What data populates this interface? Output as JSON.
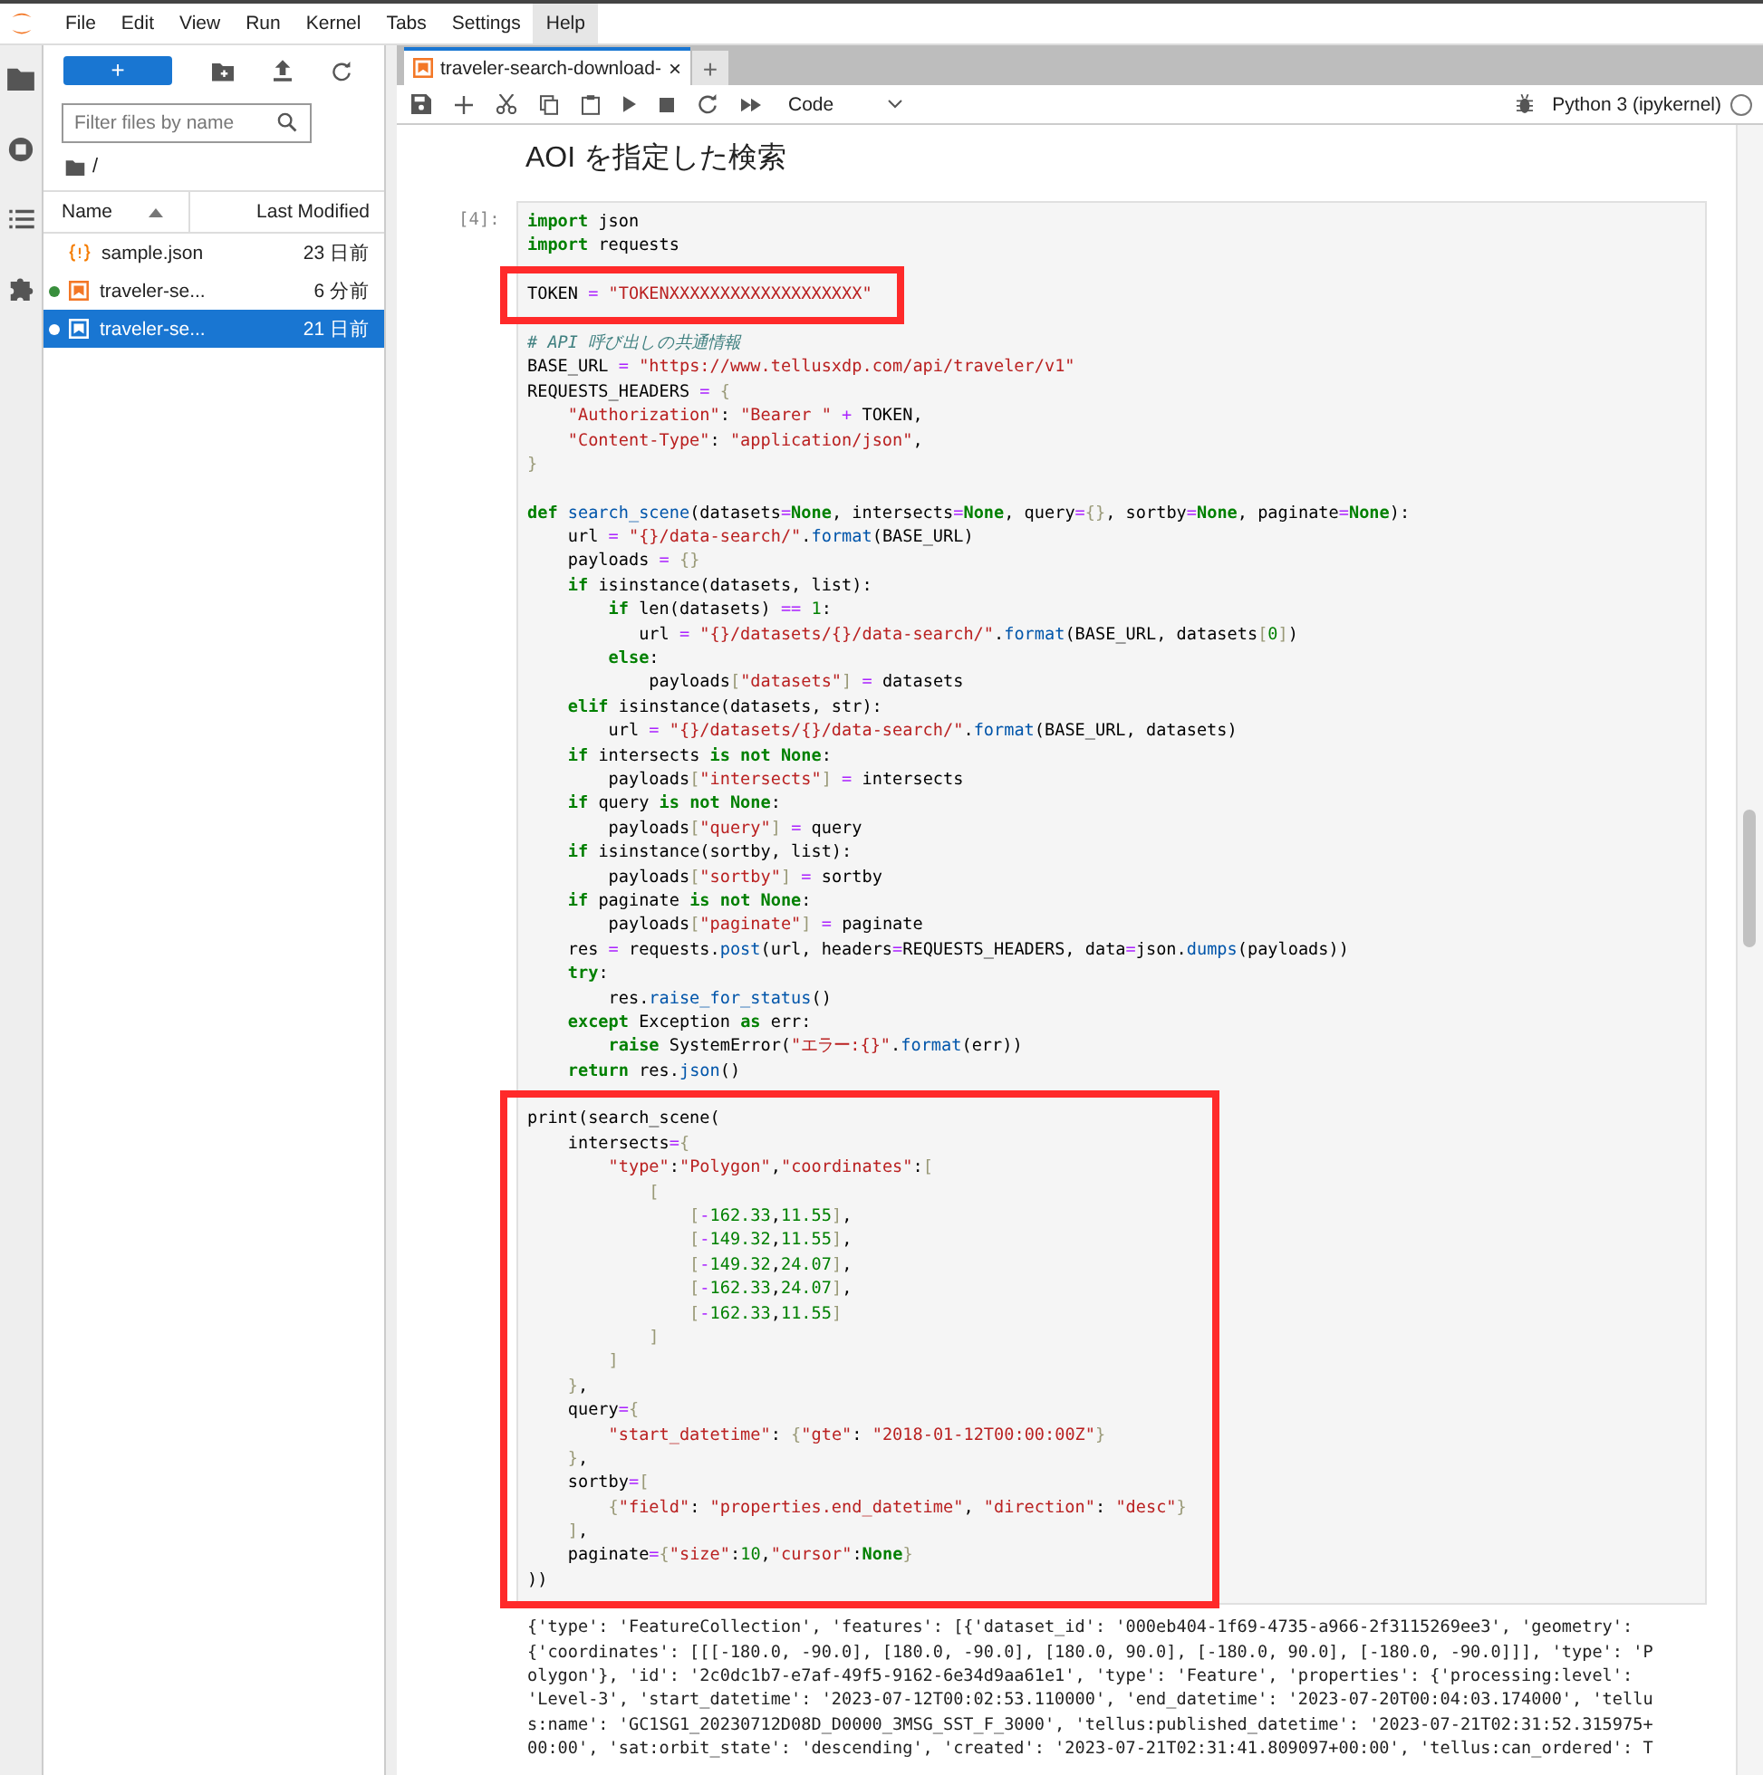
{
  "menu": [
    {
      "label": "File",
      "selected": false
    },
    {
      "label": "Edit",
      "selected": false
    },
    {
      "label": "View",
      "selected": false
    },
    {
      "label": "Run",
      "selected": false
    },
    {
      "label": "Kernel",
      "selected": false
    },
    {
      "label": "Tabs",
      "selected": false
    },
    {
      "label": "Settings",
      "selected": false
    },
    {
      "label": "Help",
      "selected": true
    }
  ],
  "file_browser": {
    "new_button": "+",
    "filter_placeholder": "Filter files by name",
    "path": "/",
    "columns": [
      "Name",
      "Last Modified"
    ],
    "files": [
      {
        "name": "sample.json",
        "modified": "23 日前",
        "kind": "json",
        "running": false,
        "selected": false
      },
      {
        "name": "traveler-se...",
        "modified": "6 分前",
        "kind": "notebook",
        "running": true,
        "selected": false
      },
      {
        "name": "traveler-se...",
        "modified": "21 日前",
        "kind": "notebook",
        "running": true,
        "selected": true
      }
    ]
  },
  "tabs": [
    {
      "label": "traveler-search-download-",
      "close": "×",
      "selected": true
    }
  ],
  "new_tab": "+",
  "toolbar": {
    "cell_type": "Code",
    "kernel": "Python 3 (ipykernel)",
    "kernel_busy": false
  },
  "notebook": {
    "heading": "AOI を指定した検索",
    "cells": [
      {
        "prompt": "[4]:",
        "blocks": [
          {
            "highlighted": false,
            "lines": [
              [
                {
                  "kind": "kw",
                  "text": "import"
                },
                {
                  "kind": "plain",
                  "text": " json"
                }
              ],
              [
                {
                  "kind": "kw",
                  "text": "import"
                },
                {
                  "kind": "plain",
                  "text": " requests"
                }
              ]
            ]
          },
          {
            "highlighted": true,
            "lines": [
              [
                {
                  "kind": "plain",
                  "text": "TOKEN"
                },
                {
                  "kind": "op",
                  "text": " = "
                },
                {
                  "kind": "str",
                  "text": "\"TOKENXXXXXXXXXXXXXXXXXXX\""
                }
              ]
            ]
          },
          {
            "highlighted": false,
            "lines": [
              [
                {
                  "kind": "comment",
                  "text": "# API 呼び出しの共通情報"
                }
              ],
              [
                {
                  "kind": "plain",
                  "text": "BASE_URL"
                },
                {
                  "kind": "op",
                  "text": " = "
                },
                {
                  "kind": "str",
                  "text": "\"https://www.tellusxdp.com/api/traveler/v1\""
                }
              ],
              [
                {
                  "kind": "plain",
                  "text": "REQUESTS_HEADERS"
                },
                {
                  "kind": "op",
                  "text": " = "
                },
                {
                  "kind": "br",
                  "text": "{"
                }
              ],
              [
                {
                  "kind": "str",
                  "text": "    \"Authorization\""
                },
                {
                  "kind": "plain",
                  "text": ": "
                },
                {
                  "kind": "str",
                  "text": "\"Bearer \""
                },
                {
                  "kind": "op",
                  "text": " + "
                },
                {
                  "kind": "plain",
                  "text": "TOKEN,"
                }
              ],
              [
                {
                  "kind": "str",
                  "text": "    \"Content-Type\""
                },
                {
                  "kind": "plain",
                  "text": ": "
                },
                {
                  "kind": "str",
                  "text": "\"application/json\""
                },
                {
                  "kind": "plain",
                  "text": ","
                }
              ],
              [
                {
                  "kind": "br",
                  "text": "}"
                }
              ]
            ]
          },
          {
            "highlighted": false,
            "lines": [
              [
                {
                  "kind": "kw",
                  "text": "def"
                },
                {
                  "kind": "fn",
                  "text": " search_scene"
                },
                {
                  "kind": "plain",
                  "text": "(datasets"
                },
                {
                  "kind": "op",
                  "text": "="
                },
                {
                  "kind": "kw",
                  "text": "None"
                },
                {
                  "kind": "plain",
                  "text": ", intersects"
                },
                {
                  "kind": "op",
                  "text": "="
                },
                {
                  "kind": "kw",
                  "text": "None"
                },
                {
                  "kind": "plain",
                  "text": ", query"
                },
                {
                  "kind": "op",
                  "text": "="
                },
                {
                  "kind": "br",
                  "text": "{}"
                },
                {
                  "kind": "plain",
                  "text": ", sortby"
                },
                {
                  "kind": "op",
                  "text": "="
                },
                {
                  "kind": "kw",
                  "text": "None"
                },
                {
                  "kind": "plain",
                  "text": ", paginate"
                },
                {
                  "kind": "op",
                  "text": "="
                },
                {
                  "kind": "kw",
                  "text": "None"
                },
                {
                  "kind": "plain",
                  "text": "):"
                }
              ],
              [
                {
                  "kind": "plain",
                  "text": "    url"
                },
                {
                  "kind": "op",
                  "text": " = "
                },
                {
                  "kind": "str",
                  "text": "\"{}/data-search/\""
                },
                {
                  "kind": "plain",
                  "text": "."
                },
                {
                  "kind": "fn",
                  "text": "format"
                },
                {
                  "kind": "plain",
                  "text": "(BASE_URL)"
                }
              ],
              [
                {
                  "kind": "plain",
                  "text": "    payloads"
                },
                {
                  "kind": "op",
                  "text": " = "
                },
                {
                  "kind": "br",
                  "text": "{}"
                }
              ],
              [
                {
                  "kind": "kw",
                  "text": "    if"
                },
                {
                  "kind": "plain",
                  "text": " isinstance(datasets, list):"
                }
              ],
              [
                {
                  "kind": "kw",
                  "text": "        if"
                },
                {
                  "kind": "plain",
                  "text": " len(datasets)"
                },
                {
                  "kind": "op",
                  "text": " == "
                },
                {
                  "kind": "num",
                  "text": "1"
                },
                {
                  "kind": "plain",
                  "text": ":"
                }
              ],
              [
                {
                  "kind": "plain",
                  "text": "           url"
                },
                {
                  "kind": "op",
                  "text": " = "
                },
                {
                  "kind": "str",
                  "text": "\"{}/datasets/{}/data-search/\""
                },
                {
                  "kind": "plain",
                  "text": "."
                },
                {
                  "kind": "fn",
                  "text": "format"
                },
                {
                  "kind": "plain",
                  "text": "(BASE_URL, datasets"
                },
                {
                  "kind": "br",
                  "text": "["
                },
                {
                  "kind": "num",
                  "text": "0"
                },
                {
                  "kind": "br",
                  "text": "]"
                },
                {
                  "kind": "plain",
                  "text": ")"
                }
              ],
              [
                {
                  "kind": "kw",
                  "text": "        else"
                },
                {
                  "kind": "plain",
                  "text": ":"
                }
              ],
              [
                {
                  "kind": "plain",
                  "text": "            payloads"
                },
                {
                  "kind": "br",
                  "text": "["
                },
                {
                  "kind": "str",
                  "text": "\"datasets\""
                },
                {
                  "kind": "br",
                  "text": "]"
                },
                {
                  "kind": "op",
                  "text": " = "
                },
                {
                  "kind": "plain",
                  "text": "datasets"
                }
              ],
              [
                {
                  "kind": "kw",
                  "text": "    elif"
                },
                {
                  "kind": "plain",
                  "text": " isinstance(datasets, str):"
                }
              ],
              [
                {
                  "kind": "plain",
                  "text": "        url"
                },
                {
                  "kind": "op",
                  "text": " = "
                },
                {
                  "kind": "str",
                  "text": "\"{}/datasets/{}/data-search/\""
                },
                {
                  "kind": "plain",
                  "text": "."
                },
                {
                  "kind": "fn",
                  "text": "format"
                },
                {
                  "kind": "plain",
                  "text": "(BASE_URL, datasets)"
                }
              ],
              [
                {
                  "kind": "kw",
                  "text": "    if"
                },
                {
                  "kind": "plain",
                  "text": " intersects "
                },
                {
                  "kind": "kw",
                  "text": "is not None"
                },
                {
                  "kind": "plain",
                  "text": ":"
                }
              ],
              [
                {
                  "kind": "plain",
                  "text": "        payloads"
                },
                {
                  "kind": "br",
                  "text": "["
                },
                {
                  "kind": "str",
                  "text": "\"intersects\""
                },
                {
                  "kind": "br",
                  "text": "]"
                },
                {
                  "kind": "op",
                  "text": " = "
                },
                {
                  "kind": "plain",
                  "text": "intersects"
                }
              ],
              [
                {
                  "kind": "kw",
                  "text": "    if"
                },
                {
                  "kind": "plain",
                  "text": " query "
                },
                {
                  "kind": "kw",
                  "text": "is not None"
                },
                {
                  "kind": "plain",
                  "text": ":"
                }
              ],
              [
                {
                  "kind": "plain",
                  "text": "        payloads"
                },
                {
                  "kind": "br",
                  "text": "["
                },
                {
                  "kind": "str",
                  "text": "\"query\""
                },
                {
                  "kind": "br",
                  "text": "]"
                },
                {
                  "kind": "op",
                  "text": " = "
                },
                {
                  "kind": "plain",
                  "text": "query"
                }
              ],
              [
                {
                  "kind": "kw",
                  "text": "    if"
                },
                {
                  "kind": "plain",
                  "text": " isinstance(sortby, list):"
                }
              ],
              [
                {
                  "kind": "plain",
                  "text": "        payloads"
                },
                {
                  "kind": "br",
                  "text": "["
                },
                {
                  "kind": "str",
                  "text": "\"sortby\""
                },
                {
                  "kind": "br",
                  "text": "]"
                },
                {
                  "kind": "op",
                  "text": " = "
                },
                {
                  "kind": "plain",
                  "text": "sortby"
                }
              ],
              [
                {
                  "kind": "kw",
                  "text": "    if"
                },
                {
                  "kind": "plain",
                  "text": " paginate "
                },
                {
                  "kind": "kw",
                  "text": "is not None"
                },
                {
                  "kind": "plain",
                  "text": ":"
                }
              ],
              [
                {
                  "kind": "plain",
                  "text": "        payloads"
                },
                {
                  "kind": "br",
                  "text": "["
                },
                {
                  "kind": "str",
                  "text": "\"paginate\""
                },
                {
                  "kind": "br",
                  "text": "]"
                },
                {
                  "kind": "op",
                  "text": " = "
                },
                {
                  "kind": "plain",
                  "text": "paginate"
                }
              ],
              [
                {
                  "kind": "plain",
                  "text": "    res"
                },
                {
                  "kind": "op",
                  "text": " = "
                },
                {
                  "kind": "plain",
                  "text": "requests."
                },
                {
                  "kind": "fn",
                  "text": "post"
                },
                {
                  "kind": "plain",
                  "text": "(url, headers"
                },
                {
                  "kind": "op",
                  "text": "="
                },
                {
                  "kind": "plain",
                  "text": "REQUESTS_HEADERS, data"
                },
                {
                  "kind": "op",
                  "text": "="
                },
                {
                  "kind": "plain",
                  "text": "json."
                },
                {
                  "kind": "fn",
                  "text": "dumps"
                },
                {
                  "kind": "plain",
                  "text": "(payloads))"
                }
              ],
              [
                {
                  "kind": "kw",
                  "text": "    try"
                },
                {
                  "kind": "plain",
                  "text": ":"
                }
              ],
              [
                {
                  "kind": "plain",
                  "text": "        res."
                },
                {
                  "kind": "fn",
                  "text": "raise_for_status"
                },
                {
                  "kind": "plain",
                  "text": "()"
                }
              ],
              [
                {
                  "kind": "kw",
                  "text": "    except"
                },
                {
                  "kind": "plain",
                  "text": " Exception "
                },
                {
                  "kind": "kw",
                  "text": "as"
                },
                {
                  "kind": "plain",
                  "text": " err:"
                }
              ],
              [
                {
                  "kind": "kw",
                  "text": "        raise"
                },
                {
                  "kind": "plain",
                  "text": " SystemError("
                },
                {
                  "kind": "str",
                  "text": "\"エラー:{}\""
                },
                {
                  "kind": "plain",
                  "text": "."
                },
                {
                  "kind": "fn",
                  "text": "format"
                },
                {
                  "kind": "plain",
                  "text": "(err))"
                }
              ],
              [
                {
                  "kind": "kw",
                  "text": "    return"
                },
                {
                  "kind": "plain",
                  "text": " res."
                },
                {
                  "kind": "fn",
                  "text": "json"
                },
                {
                  "kind": "plain",
                  "text": "()"
                }
              ]
            ]
          },
          {
            "highlighted": true,
            "lines": [
              [
                {
                  "kind": "plain",
                  "text": "print(search_scene("
                }
              ],
              [
                {
                  "kind": "plain",
                  "text": "    intersects"
                },
                {
                  "kind": "op",
                  "text": "="
                },
                {
                  "kind": "br",
                  "text": "{"
                }
              ],
              [
                {
                  "kind": "str",
                  "text": "        \"type\""
                },
                {
                  "kind": "plain",
                  "text": ":"
                },
                {
                  "kind": "str",
                  "text": "\"Polygon\""
                },
                {
                  "kind": "plain",
                  "text": ","
                },
                {
                  "kind": "str",
                  "text": "\"coordinates\""
                },
                {
                  "kind": "plain",
                  "text": ":"
                },
                {
                  "kind": "br",
                  "text": "["
                }
              ],
              [
                {
                  "kind": "br",
                  "text": "            ["
                }
              ],
              [
                {
                  "kind": "br",
                  "text": "                ["
                },
                {
                  "kind": "op",
                  "text": "-"
                },
                {
                  "kind": "num",
                  "text": "162.33"
                },
                {
                  "kind": "plain",
                  "text": ","
                },
                {
                  "kind": "num",
                  "text": "11.55"
                },
                {
                  "kind": "br",
                  "text": "]"
                },
                {
                  "kind": "plain",
                  "text": ","
                }
              ],
              [
                {
                  "kind": "br",
                  "text": "                ["
                },
                {
                  "kind": "op",
                  "text": "-"
                },
                {
                  "kind": "num",
                  "text": "149.32"
                },
                {
                  "kind": "plain",
                  "text": ","
                },
                {
                  "kind": "num",
                  "text": "11.55"
                },
                {
                  "kind": "br",
                  "text": "]"
                },
                {
                  "kind": "plain",
                  "text": ","
                }
              ],
              [
                {
                  "kind": "br",
                  "text": "                ["
                },
                {
                  "kind": "op",
                  "text": "-"
                },
                {
                  "kind": "num",
                  "text": "149.32"
                },
                {
                  "kind": "plain",
                  "text": ","
                },
                {
                  "kind": "num",
                  "text": "24.07"
                },
                {
                  "kind": "br",
                  "text": "]"
                },
                {
                  "kind": "plain",
                  "text": ","
                }
              ],
              [
                {
                  "kind": "br",
                  "text": "                ["
                },
                {
                  "kind": "op",
                  "text": "-"
                },
                {
                  "kind": "num",
                  "text": "162.33"
                },
                {
                  "kind": "plain",
                  "text": ","
                },
                {
                  "kind": "num",
                  "text": "24.07"
                },
                {
                  "kind": "br",
                  "text": "]"
                },
                {
                  "kind": "plain",
                  "text": ","
                }
              ],
              [
                {
                  "kind": "br",
                  "text": "                ["
                },
                {
                  "kind": "op",
                  "text": "-"
                },
                {
                  "kind": "num",
                  "text": "162.33"
                },
                {
                  "kind": "plain",
                  "text": ","
                },
                {
                  "kind": "num",
                  "text": "11.55"
                },
                {
                  "kind": "br",
                  "text": "]"
                }
              ],
              [
                {
                  "kind": "br",
                  "text": "            ]"
                }
              ],
              [
                {
                  "kind": "br",
                  "text": "        ]"
                }
              ],
              [
                {
                  "kind": "br",
                  "text": "    }"
                },
                {
                  "kind": "plain",
                  "text": ","
                }
              ],
              [
                {
                  "kind": "plain",
                  "text": "    query"
                },
                {
                  "kind": "op",
                  "text": "="
                },
                {
                  "kind": "br",
                  "text": "{"
                }
              ],
              [
                {
                  "kind": "str",
                  "text": "        \"start_datetime\""
                },
                {
                  "kind": "plain",
                  "text": ": "
                },
                {
                  "kind": "br",
                  "text": "{"
                },
                {
                  "kind": "str",
                  "text": "\"gte\""
                },
                {
                  "kind": "plain",
                  "text": ": "
                },
                {
                  "kind": "str",
                  "text": "\"2018-01-12T00:00:00Z\""
                },
                {
                  "kind": "br",
                  "text": "}"
                }
              ],
              [
                {
                  "kind": "br",
                  "text": "    }"
                },
                {
                  "kind": "plain",
                  "text": ","
                }
              ],
              [
                {
                  "kind": "plain",
                  "text": "    sortby"
                },
                {
                  "kind": "op",
                  "text": "="
                },
                {
                  "kind": "br",
                  "text": "["
                }
              ],
              [
                {
                  "kind": "br",
                  "text": "        {"
                },
                {
                  "kind": "str",
                  "text": "\"field\""
                },
                {
                  "kind": "plain",
                  "text": ": "
                },
                {
                  "kind": "str",
                  "text": "\"properties.end_datetime\""
                },
                {
                  "kind": "plain",
                  "text": ", "
                },
                {
                  "kind": "str",
                  "text": "\"direction\""
                },
                {
                  "kind": "plain",
                  "text": ": "
                },
                {
                  "kind": "str",
                  "text": "\"desc\""
                },
                {
                  "kind": "br",
                  "text": "}"
                }
              ],
              [
                {
                  "kind": "br",
                  "text": "    ]"
                },
                {
                  "kind": "plain",
                  "text": ","
                }
              ],
              [
                {
                  "kind": "plain",
                  "text": "    paginate"
                },
                {
                  "kind": "op",
                  "text": "="
                },
                {
                  "kind": "br",
                  "text": "{"
                },
                {
                  "kind": "str",
                  "text": "\"size\""
                },
                {
                  "kind": "plain",
                  "text": ":"
                },
                {
                  "kind": "num",
                  "text": "10"
                },
                {
                  "kind": "plain",
                  "text": ","
                },
                {
                  "kind": "str",
                  "text": "\"cursor\""
                },
                {
                  "kind": "plain",
                  "text": ":"
                },
                {
                  "kind": "kw",
                  "text": "None"
                },
                {
                  "kind": "br",
                  "text": "}"
                }
              ],
              [
                {
                  "kind": "plain",
                  "text": "))"
                }
              ]
            ]
          }
        ],
        "output": [
          "{'type': 'FeatureCollection', 'features': [{'dataset_id': '000eb404-1f69-4735-a966-2f3115269ee3', 'geometry':",
          "{'coordinates': [[[-180.0, -90.0], [180.0, -90.0], [180.0, 90.0], [-180.0, 90.0], [-180.0, -90.0]]], 'type': 'P",
          "olygon'}, 'id': '2c0dc1b7-e7af-49f5-9162-6e34d9aa61e1', 'type': 'Feature', 'properties': {'processing:level':",
          "'Level-3', 'start_datetime': '2023-07-12T00:02:53.110000', 'end_datetime': '2023-07-20T00:04:03.174000', 'tellu",
          "s:name': 'GC1SG1_20230712D08D_D0000_3MSG_SST_F_3000', 'tellus:published_datetime': '2023-07-21T02:31:52.315975+",
          "00:00', 'sat:orbit_state': 'descending', 'created': '2023-07-21T02:31:41.809097+00:00', 'tellus:can_ordered': T"
        ]
      }
    ]
  }
}
